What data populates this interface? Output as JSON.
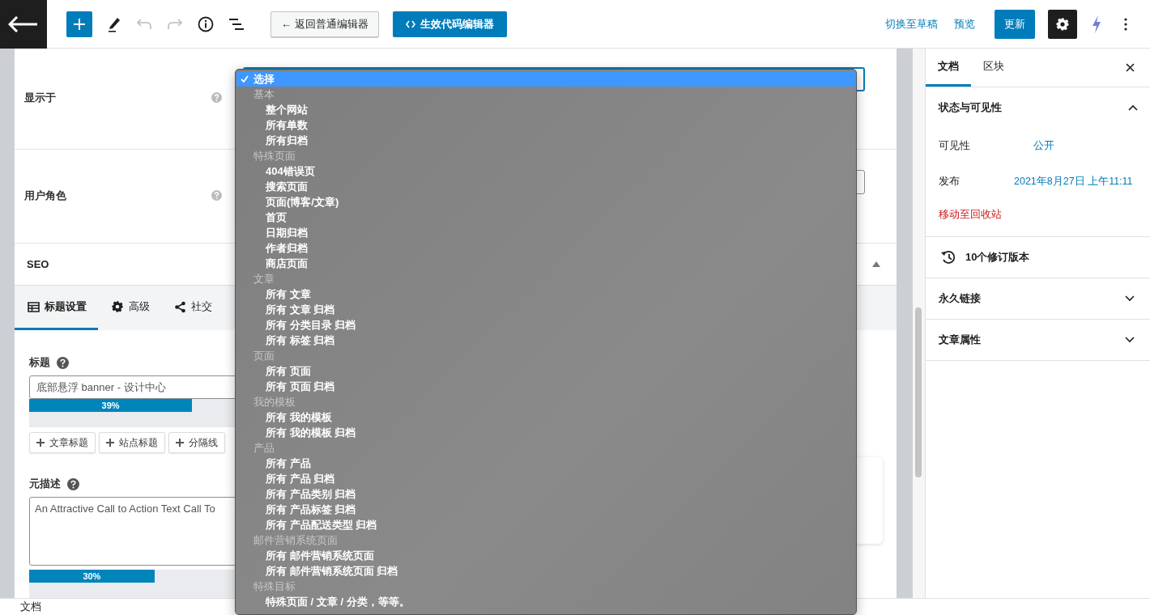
{
  "toolbar": {
    "undo_disabled": true,
    "redo_disabled": true,
    "buttons": [
      {
        "label": "← 返回普通编辑器",
        "kind": "secondary"
      },
      {
        "label": "生效代码编辑器",
        "kind": "primary"
      }
    ],
    "links": [
      "切换至草稿",
      "预览"
    ],
    "update_label": "更新",
    "settings_pressed": true
  },
  "rules": [
    {
      "label": "显示于",
      "focused": true
    },
    {
      "label": "用户角色",
      "focused": false
    }
  ],
  "seo": {
    "title": "SEO",
    "expanded": true,
    "tabs": [
      {
        "label": "标题设置",
        "selected": true
      },
      {
        "label": "高级",
        "selected": false
      },
      {
        "label": "社交",
        "selected": false
      }
    ],
    "title_field": {
      "label": "标题",
      "value": "底部悬浮 banner - 设计中心",
      "level": 0.39,
      "reading": "39%"
    },
    "tag_buttons": [
      "文章标题",
      "站点标题",
      "分隔线"
    ],
    "description_field": {
      "label": "元描述",
      "value": "An Attractive Call to Action Text Call To",
      "level": 0.3,
      "reading": "30%"
    }
  },
  "dropdown": {
    "items": [
      {
        "label": "选择",
        "kind": "option",
        "selected": true
      },
      {
        "label": "基本",
        "kind": "header"
      },
      {
        "label": "整个网站",
        "kind": "option",
        "selected": false
      },
      {
        "label": "所有单数",
        "kind": "option",
        "selected": false
      },
      {
        "label": "所有归档",
        "kind": "option",
        "selected": false
      },
      {
        "label": "特殊页面",
        "kind": "header"
      },
      {
        "label": "404错误页",
        "kind": "option",
        "selected": false
      },
      {
        "label": "搜索页面",
        "kind": "option",
        "selected": false
      },
      {
        "label": "页面(博客/文章)",
        "kind": "option",
        "selected": false
      },
      {
        "label": "首页",
        "kind": "option",
        "selected": false
      },
      {
        "label": "日期归档",
        "kind": "option",
        "selected": false
      },
      {
        "label": "作者归档",
        "kind": "option",
        "selected": false
      },
      {
        "label": "商店页面",
        "kind": "option",
        "selected": false
      },
      {
        "label": "文章",
        "kind": "header"
      },
      {
        "label": "所有 文章",
        "kind": "option",
        "selected": false
      },
      {
        "label": "所有 文章 归档",
        "kind": "option",
        "selected": false
      },
      {
        "label": "所有 分类目录 归档",
        "kind": "option",
        "selected": false
      },
      {
        "label": "所有 标签 归档",
        "kind": "option",
        "selected": false
      },
      {
        "label": "页面",
        "kind": "header"
      },
      {
        "label": "所有 页面",
        "kind": "option",
        "selected": false
      },
      {
        "label": "所有 页面 归档",
        "kind": "option",
        "selected": false
      },
      {
        "label": "我的模板",
        "kind": "header"
      },
      {
        "label": "所有 我的模板",
        "kind": "option",
        "selected": false
      },
      {
        "label": "所有 我的模板 归档",
        "kind": "option",
        "selected": false
      },
      {
        "label": "产品",
        "kind": "header"
      },
      {
        "label": "所有 产品",
        "kind": "option",
        "selected": false
      },
      {
        "label": "所有 产品 归档",
        "kind": "option",
        "selected": false
      },
      {
        "label": "所有 产品类别 归档",
        "kind": "option",
        "selected": false
      },
      {
        "label": "所有 产品标签 归档",
        "kind": "option",
        "selected": false
      },
      {
        "label": "所有 产品配送类型 归档",
        "kind": "option",
        "selected": false
      },
      {
        "label": "邮件营销系统页面",
        "kind": "header"
      },
      {
        "label": "所有 邮件营销系统页面",
        "kind": "option",
        "selected": false
      },
      {
        "label": "所有 邮件营销系统页面 归档",
        "kind": "option",
        "selected": false
      },
      {
        "label": "特殊目标",
        "kind": "header"
      },
      {
        "label": "特殊页面 / 文章 / 分类，等等。",
        "kind": "option",
        "selected": false
      }
    ]
  },
  "sidebar": {
    "tabs": [
      {
        "label": "文档",
        "selected": true
      },
      {
        "label": "区块",
        "selected": false
      }
    ],
    "status_panel": {
      "title": "状态与可见性",
      "expanded": true,
      "rows": [
        {
          "label": "可见性",
          "value": "公开"
        },
        {
          "label": "发布",
          "value": "2021年8月27日 上午11:11"
        }
      ],
      "trash": "移动至回收站"
    },
    "revisions": "10个修订版本",
    "panels": [
      {
        "title": "永久链接",
        "expanded": false
      },
      {
        "title": "文章属性",
        "expanded": false
      }
    ]
  },
  "footer": "文档"
}
